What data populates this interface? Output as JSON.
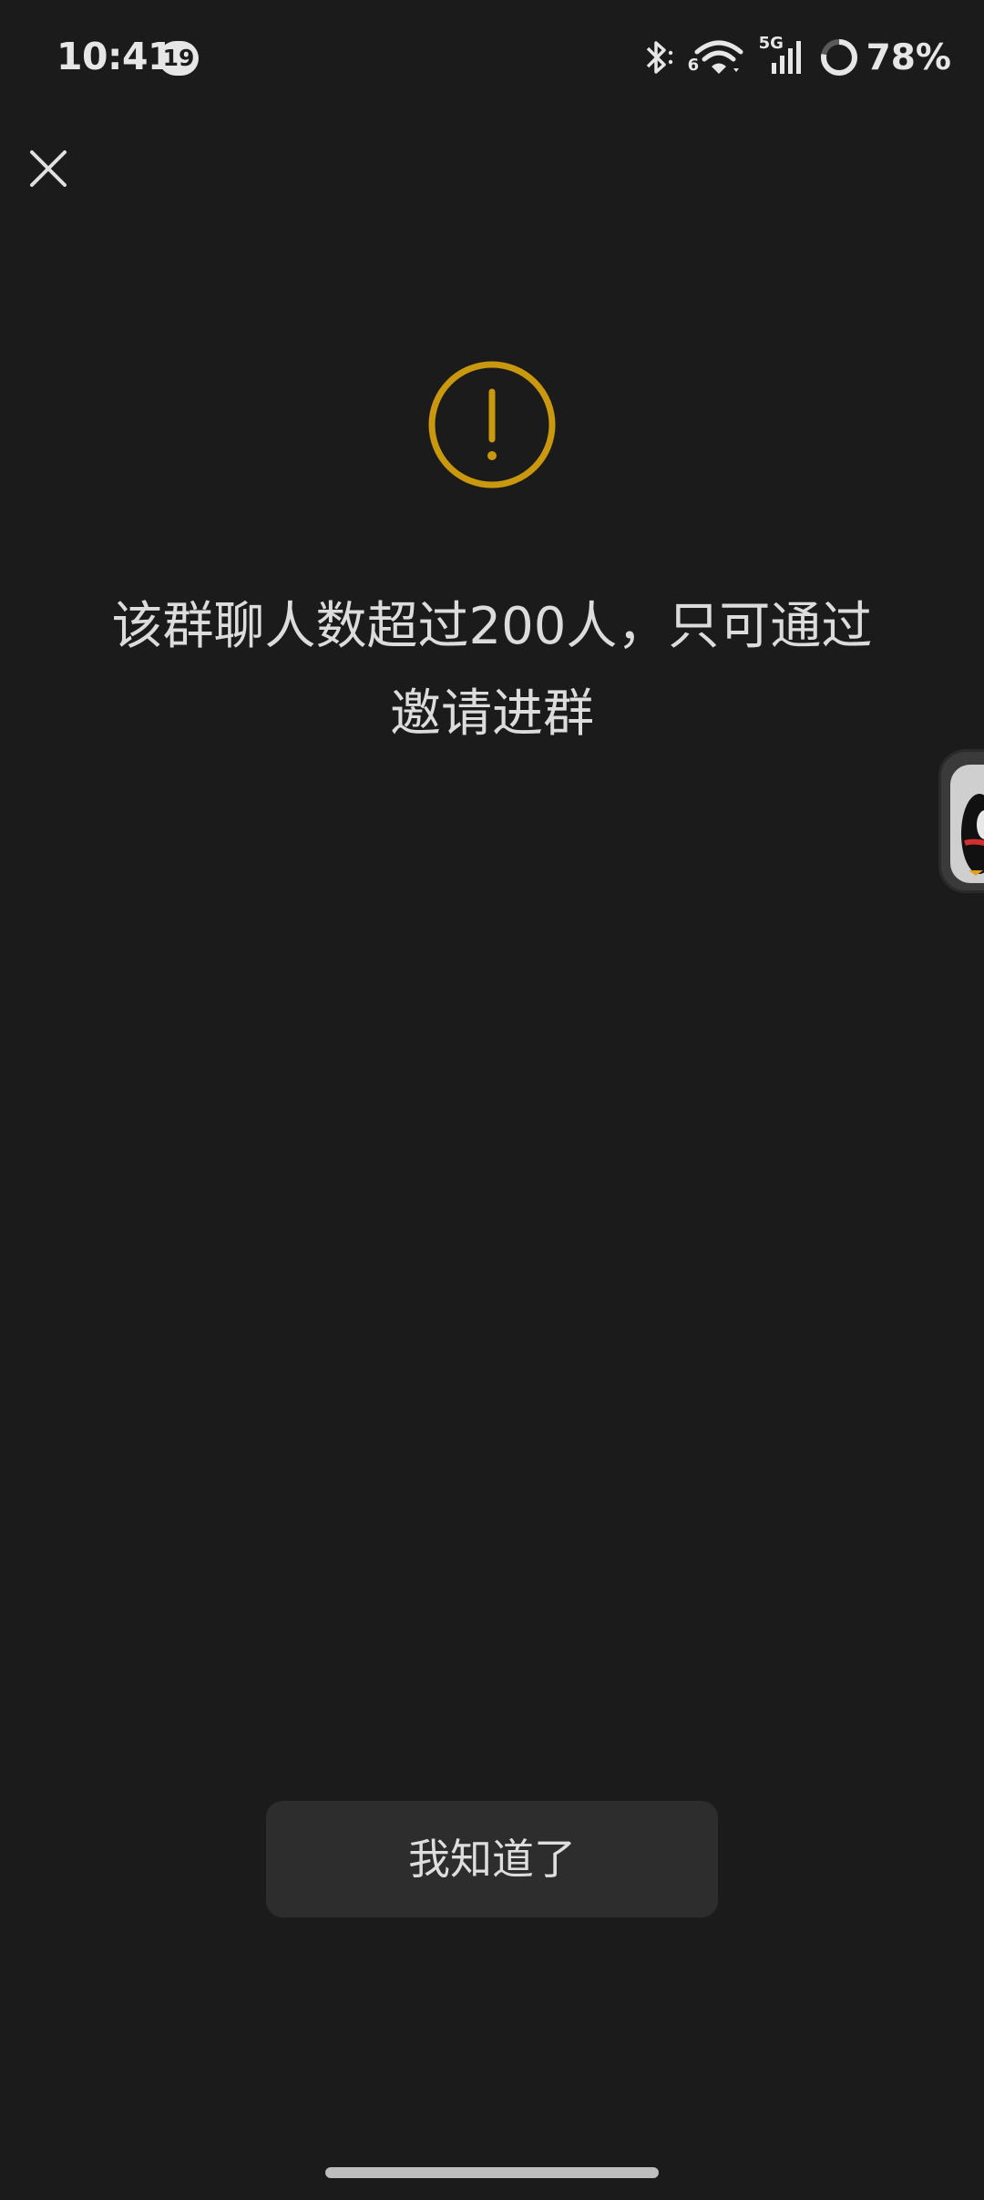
{
  "status_bar": {
    "time": "10:41",
    "notification_count": "19",
    "network_label": "5G",
    "wifi_label": "6",
    "battery": "78%",
    "battery_level": 0.78
  },
  "icons": {
    "close": "close-icon",
    "warning": "warning-icon",
    "bluetooth": "bluetooth-icon",
    "wifi": "wifi-icon",
    "signal": "signal-icon",
    "battery": "battery-ring-icon"
  },
  "colors": {
    "background": "#1b1b1b",
    "accent_warning": "#c9980f",
    "button_bg": "#2d2d2d",
    "text": "#dcdcdc"
  },
  "dialog": {
    "message_line1": "该群聊人数超过200人，只可通过",
    "message_line2": "邀请进群",
    "button_label": "我知道了"
  }
}
